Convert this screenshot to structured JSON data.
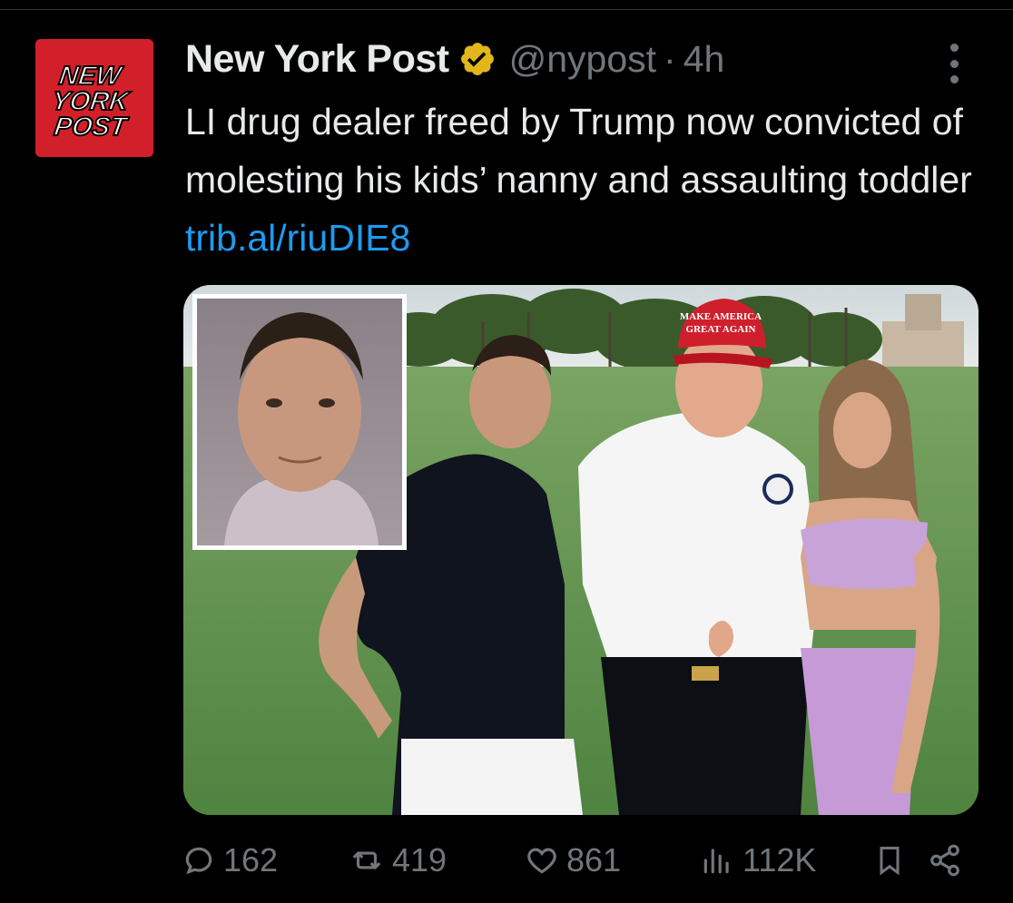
{
  "tweet": {
    "display_name": "New York Post",
    "handle": "@nypost",
    "separator": "·",
    "time": "4h",
    "text_before_link": "LI drug dealer freed by Trump now convicted of molesting his kids’ nanny and assaulting toddler ",
    "link_text": "trib.al/riuDIE8",
    "verified_icon": "verified-gold-badge-icon",
    "avatar": {
      "logo_lines": [
        "NEW",
        "YORK",
        "POST"
      ],
      "color": "#d2202a"
    },
    "image": {
      "inset_border_color": "#ffffff",
      "cap_text_line1": "MAKE AMERICA",
      "cap_text_line2": "GREAT AGAIN"
    }
  },
  "actions": {
    "replies": "162",
    "reposts": "419",
    "likes": "861",
    "views": "112K"
  },
  "colors": {
    "background": "#000000",
    "text": "#e7e9ea",
    "muted": "#71767b",
    "link": "#1d9bf0",
    "verified": "#e2b719"
  }
}
